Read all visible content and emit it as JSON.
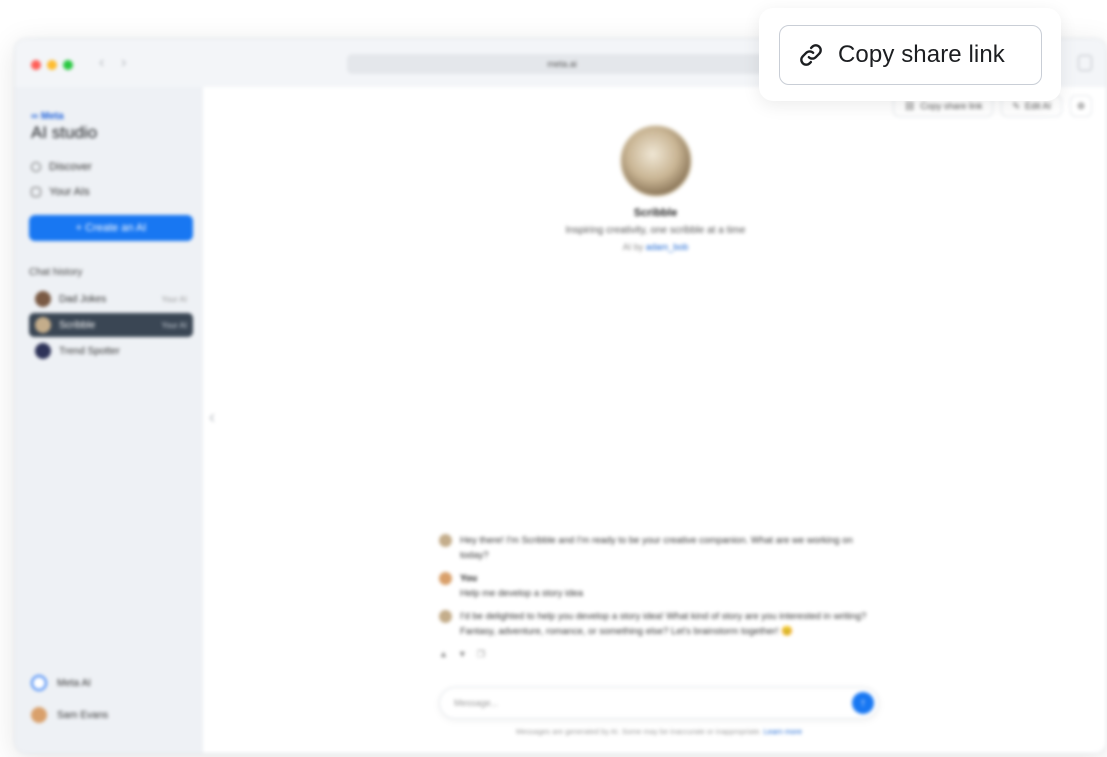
{
  "browser": {
    "url": "meta.ai"
  },
  "sidebar": {
    "brand": "∞ Meta",
    "title": "AI studio",
    "links": [
      {
        "label": "Discover",
        "icon": "compass-icon"
      },
      {
        "label": "Your AIs",
        "icon": "user-icon"
      }
    ],
    "create_button": "+ Create an AI",
    "chat_history_label": "Chat history",
    "chats": [
      {
        "name": "Dad Jokes",
        "tag": "Your AI",
        "color": "#7a5a44"
      },
      {
        "name": "Scribble",
        "tag": "Your AI",
        "color": "#c4ad8b"
      },
      {
        "name": "Trend Spotter",
        "tag": "",
        "color": "#2e3358"
      }
    ],
    "bottom": [
      {
        "label": "Meta AI",
        "icon": "meta-ai-icon"
      },
      {
        "label": "Sam Evans",
        "icon": "avatar"
      }
    ]
  },
  "main": {
    "top_actions": {
      "copy_share_link": "Copy share link",
      "edit_ai": "Edit AI"
    },
    "profile": {
      "name": "Scribble",
      "tagline": "Inspiring creativity, one scribble at a time",
      "byline_prefix": "AI by ",
      "byline_user": "adam_bob"
    },
    "messages": [
      {
        "sender": "ai",
        "text": "Hey there! I'm Scribble and I'm ready to be your creative companion. What are we working on today?"
      },
      {
        "sender": "You",
        "text": "Help me develop a story idea"
      },
      {
        "sender": "ai",
        "text": "I'd be delighted to help you develop a story idea! What kind of story are you interested in writing? Fantasy, adventure, romance, or something else? Let's brainstorm together! 😊"
      }
    ],
    "composer_placeholder": "Message...",
    "disclaimer": "Messages are generated by AI. Some may be inaccurate or inappropriate.",
    "disclaimer_link": "Learn more"
  },
  "callout": {
    "button_label": "Copy share link",
    "icon": "link-icon"
  }
}
